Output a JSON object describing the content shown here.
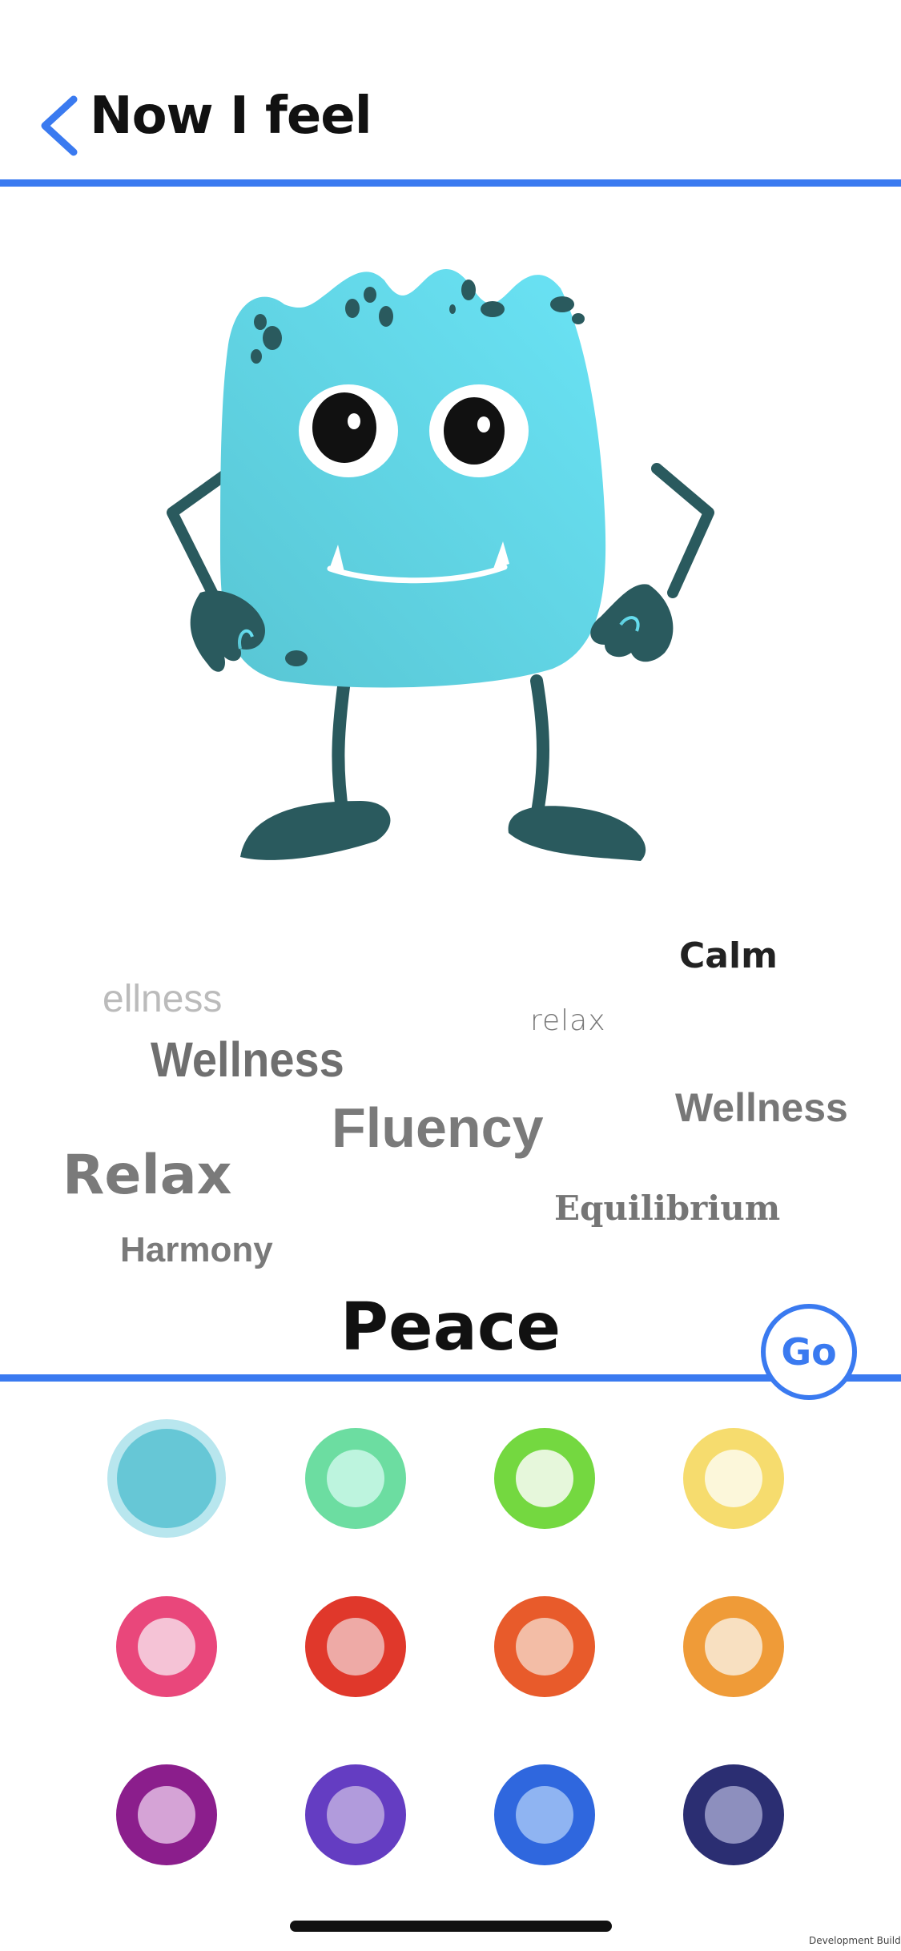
{
  "colors": {
    "accent": "#3A7AF0",
    "monster": "#5FD3E6",
    "monster_dark": "#2A5A5E"
  },
  "header": {
    "title": "Now I feel",
    "back_icon": "chevron-left-icon"
  },
  "word_cloud": {
    "calm": "Calm",
    "ellness": "ellness",
    "relax_small": "relax",
    "wellness_1": "Wellness",
    "fluency": "Fluency",
    "wellness_2": "Wellness",
    "relax_big": "Relax",
    "equilibrium": "Equilibrium",
    "harmony": "Harmony"
  },
  "selected_feeling": "Peace",
  "go_button": {
    "label": "Go"
  },
  "color_options": [
    {
      "outer": "#66C7D6",
      "inner": "#66C7D6",
      "ring": "#B8E6EE",
      "selected": true
    },
    {
      "outer": "#6CDDA1",
      "inner": "#BDF4DE"
    },
    {
      "outer": "#74D840",
      "inner": "#E6F7DB"
    },
    {
      "outer": "#F6DC6E",
      "inner": "#FCF7DA"
    },
    {
      "outer": "#E9477B",
      "inner": "#F5C3D6"
    },
    {
      "outer": "#E0382B",
      "inner": "#EEAAA6"
    },
    {
      "outer": "#E85B2B",
      "inner": "#F3BDA6"
    },
    {
      "outer": "#EF9B38",
      "inner": "#F8E0C1"
    },
    {
      "outer": "#8B1E8C",
      "inner": "#D5A3D6"
    },
    {
      "outer": "#643DC2",
      "inner": "#B19BDC"
    },
    {
      "outer": "#2F67DE",
      "inner": "#8FB4F2"
    },
    {
      "outer": "#2B2E72",
      "inner": "#8D8FBE"
    }
  ],
  "dev_badge": "Development Build"
}
